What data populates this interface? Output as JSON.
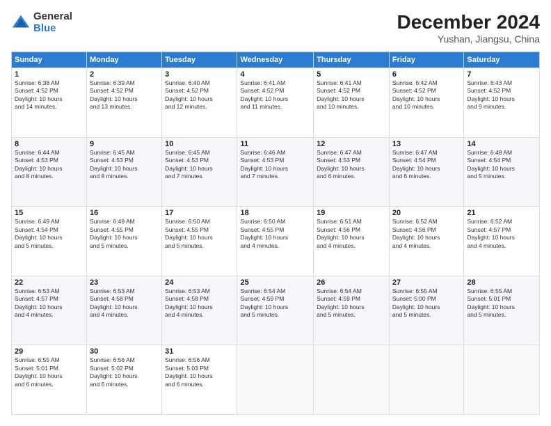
{
  "logo": {
    "general": "General",
    "blue": "Blue"
  },
  "header": {
    "title": "December 2024",
    "subtitle": "Yushan, Jiangsu, China"
  },
  "weekdays": [
    "Sunday",
    "Monday",
    "Tuesday",
    "Wednesday",
    "Thursday",
    "Friday",
    "Saturday"
  ],
  "weeks": [
    [
      {
        "day": "1",
        "sunrise": "6:38 AM",
        "sunset": "4:52 PM",
        "daylight": "10 hours and 14 minutes."
      },
      {
        "day": "2",
        "sunrise": "6:39 AM",
        "sunset": "4:52 PM",
        "daylight": "10 hours and 13 minutes."
      },
      {
        "day": "3",
        "sunrise": "6:40 AM",
        "sunset": "4:52 PM",
        "daylight": "10 hours and 12 minutes."
      },
      {
        "day": "4",
        "sunrise": "6:41 AM",
        "sunset": "4:52 PM",
        "daylight": "10 hours and 11 minutes."
      },
      {
        "day": "5",
        "sunrise": "6:41 AM",
        "sunset": "4:52 PM",
        "daylight": "10 hours and 10 minutes."
      },
      {
        "day": "6",
        "sunrise": "6:42 AM",
        "sunset": "4:52 PM",
        "daylight": "10 hours and 10 minutes."
      },
      {
        "day": "7",
        "sunrise": "6:43 AM",
        "sunset": "4:52 PM",
        "daylight": "10 hours and 9 minutes."
      }
    ],
    [
      {
        "day": "8",
        "sunrise": "6:44 AM",
        "sunset": "4:53 PM",
        "daylight": "10 hours and 8 minutes."
      },
      {
        "day": "9",
        "sunrise": "6:45 AM",
        "sunset": "4:53 PM",
        "daylight": "10 hours and 8 minutes."
      },
      {
        "day": "10",
        "sunrise": "6:45 AM",
        "sunset": "4:53 PM",
        "daylight": "10 hours and 7 minutes."
      },
      {
        "day": "11",
        "sunrise": "6:46 AM",
        "sunset": "4:53 PM",
        "daylight": "10 hours and 7 minutes."
      },
      {
        "day": "12",
        "sunrise": "6:47 AM",
        "sunset": "4:53 PM",
        "daylight": "10 hours and 6 minutes."
      },
      {
        "day": "13",
        "sunrise": "6:47 AM",
        "sunset": "4:54 PM",
        "daylight": "10 hours and 6 minutes."
      },
      {
        "day": "14",
        "sunrise": "6:48 AM",
        "sunset": "4:54 PM",
        "daylight": "10 hours and 5 minutes."
      }
    ],
    [
      {
        "day": "15",
        "sunrise": "6:49 AM",
        "sunset": "4:54 PM",
        "daylight": "10 hours and 5 minutes."
      },
      {
        "day": "16",
        "sunrise": "6:49 AM",
        "sunset": "4:55 PM",
        "daylight": "10 hours and 5 minutes."
      },
      {
        "day": "17",
        "sunrise": "6:50 AM",
        "sunset": "4:55 PM",
        "daylight": "10 hours and 5 minutes."
      },
      {
        "day": "18",
        "sunrise": "6:50 AM",
        "sunset": "4:55 PM",
        "daylight": "10 hours and 4 minutes."
      },
      {
        "day": "19",
        "sunrise": "6:51 AM",
        "sunset": "4:56 PM",
        "daylight": "10 hours and 4 minutes."
      },
      {
        "day": "20",
        "sunrise": "6:52 AM",
        "sunset": "4:56 PM",
        "daylight": "10 hours and 4 minutes."
      },
      {
        "day": "21",
        "sunrise": "6:52 AM",
        "sunset": "4:57 PM",
        "daylight": "10 hours and 4 minutes."
      }
    ],
    [
      {
        "day": "22",
        "sunrise": "6:53 AM",
        "sunset": "4:57 PM",
        "daylight": "10 hours and 4 minutes."
      },
      {
        "day": "23",
        "sunrise": "6:53 AM",
        "sunset": "4:58 PM",
        "daylight": "10 hours and 4 minutes."
      },
      {
        "day": "24",
        "sunrise": "6:53 AM",
        "sunset": "4:58 PM",
        "daylight": "10 hours and 4 minutes."
      },
      {
        "day": "25",
        "sunrise": "6:54 AM",
        "sunset": "4:59 PM",
        "daylight": "10 hours and 5 minutes."
      },
      {
        "day": "26",
        "sunrise": "6:54 AM",
        "sunset": "4:59 PM",
        "daylight": "10 hours and 5 minutes."
      },
      {
        "day": "27",
        "sunrise": "6:55 AM",
        "sunset": "5:00 PM",
        "daylight": "10 hours and 5 minutes."
      },
      {
        "day": "28",
        "sunrise": "6:55 AM",
        "sunset": "5:01 PM",
        "daylight": "10 hours and 5 minutes."
      }
    ],
    [
      {
        "day": "29",
        "sunrise": "6:55 AM",
        "sunset": "5:01 PM",
        "daylight": "10 hours and 6 minutes."
      },
      {
        "day": "30",
        "sunrise": "6:56 AM",
        "sunset": "5:02 PM",
        "daylight": "10 hours and 6 minutes."
      },
      {
        "day": "31",
        "sunrise": "6:56 AM",
        "sunset": "5:03 PM",
        "daylight": "10 hours and 6 minutes."
      },
      null,
      null,
      null,
      null
    ]
  ],
  "labels": {
    "sunrise": "Sunrise:",
    "sunset": "Sunset:",
    "daylight": "Daylight:"
  }
}
